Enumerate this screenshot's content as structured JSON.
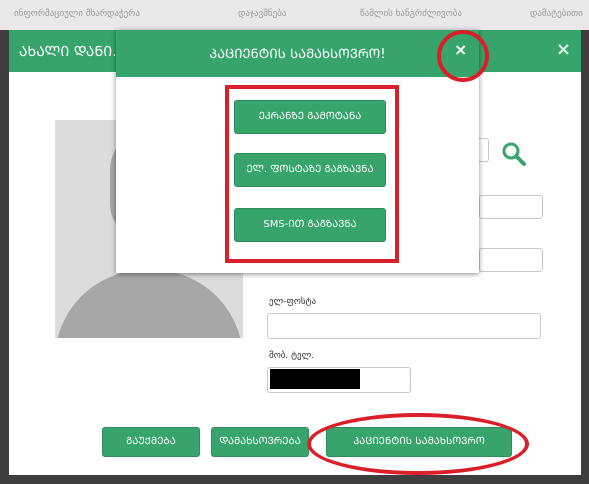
{
  "background_nav": {
    "items": [
      "ინფორმაციული მხარდაჭერა",
      "დაჯავშნება",
      "წამლის ხანგრძლივობა",
      "დამატებითი"
    ]
  },
  "outer_modal": {
    "title": "ᲐᲮᲐᲚᲘ ᲓᲐᲜᲘ...",
    "close_icon": "close-icon",
    "email_label": "ელ-ფოსტა",
    "mobile_label": "მობ. ტელ.",
    "search_icon": "search-icon",
    "buttons": {
      "cancel": "ᲒᲐᲣᲥᲛᲔᲑᲐ",
      "save": "ᲓᲐᲛᲐᲮᲡᲝᲕᲠᲔᲑᲐ",
      "patient_reminder": "ᲞᲐᲪᲘᲔᲜᲢᲘᲡ ᲡᲐᲛᲐᲮᲡᲝᲕᲠᲝ"
    }
  },
  "inner_modal": {
    "title": "ᲞᲐᲪᲘᲔᲜᲢᲘᲡ ᲡᲐᲛᲐᲮᲡᲝᲕᲠᲝ!",
    "close_icon": "close-icon",
    "buttons": {
      "print": "ᲔᲙᲠᲐᲜᲖᲔ ᲒᲐᲛᲝᲢᲐᲜᲐ",
      "email": "ᲔᲚ. ᲤᲝᲡᲢᲐᲖᲔ ᲒᲐᲒᲖᲐᲕᲜᲐ",
      "sms": "SMS-ᲘᲗ ᲒᲐᲒᲖᲐᲕᲜᲐ"
    }
  },
  "colors": {
    "accent_green": "#36a46b",
    "highlight_red": "#d9202a"
  }
}
